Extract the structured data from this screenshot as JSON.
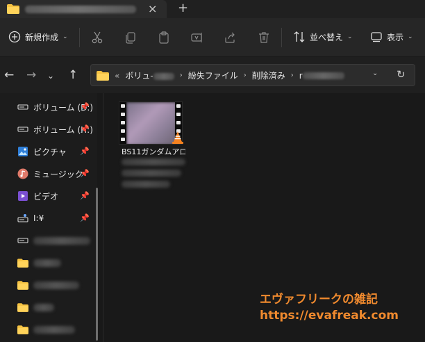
{
  "window": {
    "new_tab_glyph": "+",
    "close_tab_glyph": "×"
  },
  "toolbar": {
    "new_label": "新規作成",
    "sort_label": "並べ替え",
    "view_label": "表示",
    "icons": [
      "cut-icon",
      "copy-icon",
      "paste-icon",
      "rename-icon",
      "share-icon",
      "delete-icon"
    ]
  },
  "address": {
    "overflow": "«",
    "crumbs": [
      "ボリュ-",
      "紛失ファイル",
      "削除済み",
      "r"
    ]
  },
  "sidebar": {
    "items": [
      {
        "label": "ボリューム (D:)",
        "icon": "drive-icon",
        "pinned": true
      },
      {
        "label": "ボリューム (H:)",
        "icon": "drive-icon",
        "pinned": true
      },
      {
        "label": "ピクチャ",
        "icon": "pictures-icon",
        "pinned": true
      },
      {
        "label": "ミュージック",
        "icon": "music-icon",
        "pinned": true
      },
      {
        "label": "ビデオ",
        "icon": "videos-icon",
        "pinned": true
      },
      {
        "label": "I:¥",
        "icon": "drive-icon",
        "pinned": true
      }
    ],
    "pin_glyph": "📌"
  },
  "content": {
    "file": {
      "name": "BS11ガンダムアロ"
    }
  },
  "watermark": {
    "line1": "エヴァフリークの雑記",
    "line2": "https://evafreak.com"
  },
  "colors": {
    "accent_folder": "#f5c242",
    "watermark": "#f08a2e"
  }
}
